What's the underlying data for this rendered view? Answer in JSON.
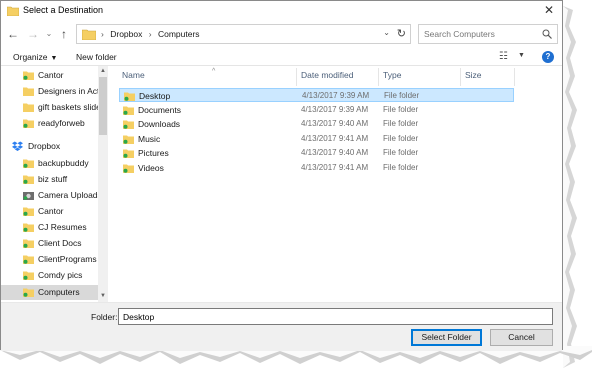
{
  "window": {
    "title": "Select a Destination",
    "close_glyph": "✕"
  },
  "nav": {
    "back_glyph": "←",
    "forward_glyph": "→",
    "recent_glyph": "⌄",
    "up_glyph": "↑"
  },
  "address": {
    "sep1": "›",
    "segment1": "Dropbox",
    "sep2": "›",
    "segment2": "Computers",
    "dropdown_glyph": "⌄",
    "refresh_glyph": "↻"
  },
  "search": {
    "placeholder": "Search Computers"
  },
  "toolbar": {
    "organize_label": "Organize",
    "organize_caret": "▼",
    "new_folder_label": "New folder",
    "view_glyph": "☷",
    "view_dropdown_glyph": "▼",
    "help_glyph": "?"
  },
  "sidebar": {
    "items": [
      {
        "label": "Cantor"
      },
      {
        "label": "Designers in Act"
      },
      {
        "label": "gift baskets slide"
      },
      {
        "label": "readyforweb"
      },
      {
        "label": "Dropbox"
      },
      {
        "label": "backupbuddy"
      },
      {
        "label": "biz stuff"
      },
      {
        "label": "Camera Uploads"
      },
      {
        "label": "Cantor"
      },
      {
        "label": "CJ Resumes"
      },
      {
        "label": "Client Docs"
      },
      {
        "label": "ClientPrograms"
      },
      {
        "label": "Comdy pics"
      },
      {
        "label": "Computers"
      }
    ],
    "scroll_up_glyph": "▲",
    "scroll_down_glyph": "▼"
  },
  "columns": {
    "name": "Name",
    "date": "Date modified",
    "type": "Type",
    "size": "Size",
    "sort_glyph": "^"
  },
  "files": [
    {
      "name": "Desktop",
      "date": "4/13/2017 9:39 AM",
      "type": "File folder"
    },
    {
      "name": "Documents",
      "date": "4/13/2017 9:39 AM",
      "type": "File folder"
    },
    {
      "name": "Downloads",
      "date": "4/13/2017 9:40 AM",
      "type": "File folder"
    },
    {
      "name": "Music",
      "date": "4/13/2017 9:41 AM",
      "type": "File folder"
    },
    {
      "name": "Pictures",
      "date": "4/13/2017 9:40 AM",
      "type": "File folder"
    },
    {
      "name": "Videos",
      "date": "4/13/2017 9:41 AM",
      "type": "File folder"
    }
  ],
  "footer": {
    "folder_label": "Folder:",
    "folder_value": "Desktop",
    "select_label": "Select Folder",
    "cancel_label": "Cancel"
  },
  "colors": {
    "folder": "#f5cf63",
    "sync_badge": "#2aa84a",
    "selection": "#cce8ff",
    "accent": "#0078d7"
  }
}
